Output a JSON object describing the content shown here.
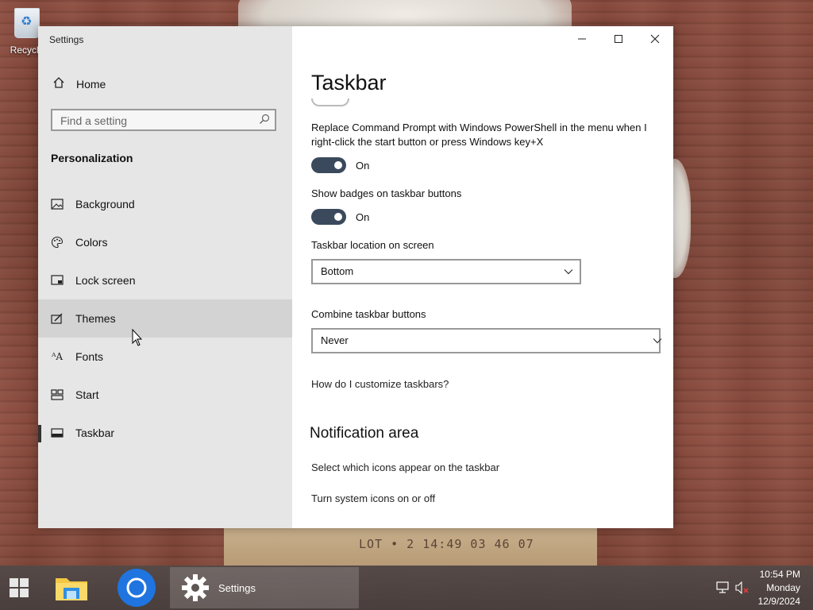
{
  "desktop": {
    "recycle_bin_label": "Recycle",
    "object_text": "LOT • 2 14:49 03 46 07"
  },
  "window": {
    "title": "Settings",
    "controls": [
      "minimize",
      "maximize",
      "close"
    ]
  },
  "sidebar": {
    "home_label": "Home",
    "search_placeholder": "Find a setting",
    "section": "Personalization",
    "items": [
      {
        "label": "Background",
        "icon": "image-icon"
      },
      {
        "label": "Colors",
        "icon": "palette-icon"
      },
      {
        "label": "Lock screen",
        "icon": "lock-screen-icon"
      },
      {
        "label": "Themes",
        "icon": "themes-icon",
        "hover": true
      },
      {
        "label": "Fonts",
        "icon": "fonts-icon"
      },
      {
        "label": "Start",
        "icon": "start-icon"
      },
      {
        "label": "Taskbar",
        "icon": "taskbar-icon",
        "selected": true
      }
    ]
  },
  "main": {
    "title": "Taskbar",
    "powershell": {
      "label": "Replace Command Prompt with Windows PowerShell in the menu when I right-click the start button or press Windows key+X",
      "state": "On"
    },
    "badges": {
      "label": "Show badges on taskbar buttons",
      "state": "On"
    },
    "location": {
      "label": "Taskbar location on screen",
      "value": "Bottom"
    },
    "combine": {
      "label": "Combine taskbar buttons",
      "value": "Never"
    },
    "help_link": "How do I customize taskbars?",
    "notification": {
      "heading": "Notification area",
      "link1": "Select which icons appear on the taskbar",
      "link2": "Turn system icons on or off"
    }
  },
  "taskbar": {
    "settings_label": "Settings",
    "clock": {
      "time": "10:54 PM",
      "day": "Monday",
      "date": "12/9/2024"
    }
  },
  "colors": {
    "toggle_on": "#3a4a5c",
    "sidebar_bg": "#e6e6e6",
    "hover_bg": "#d3d3d3"
  }
}
